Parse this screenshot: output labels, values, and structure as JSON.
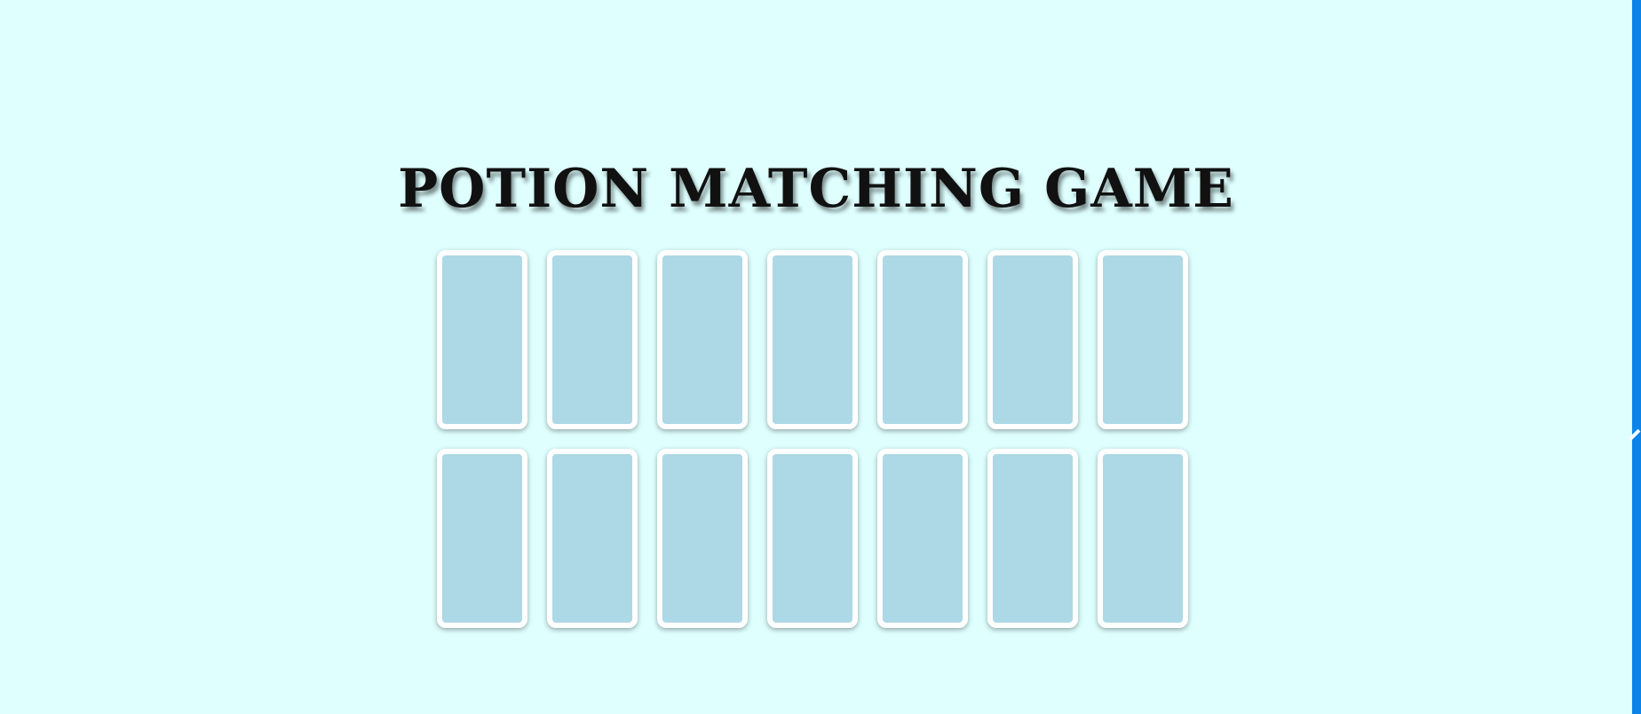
{
  "game": {
    "title": "POTION MATCHING GAME",
    "card_back_color": "#add8e6",
    "card_border_color": "#ffffff",
    "background_color": "#dfffff",
    "cards": [
      {
        "state": "face-down"
      },
      {
        "state": "face-down"
      },
      {
        "state": "face-down"
      },
      {
        "state": "face-down"
      },
      {
        "state": "face-down"
      },
      {
        "state": "face-down"
      },
      {
        "state": "face-down"
      },
      {
        "state": "face-down"
      },
      {
        "state": "face-down"
      },
      {
        "state": "face-down"
      },
      {
        "state": "face-down"
      },
      {
        "state": "face-down"
      },
      {
        "state": "face-down"
      },
      {
        "state": "face-down"
      }
    ]
  },
  "side_panel": {
    "accent_color": "#0a84e8"
  }
}
